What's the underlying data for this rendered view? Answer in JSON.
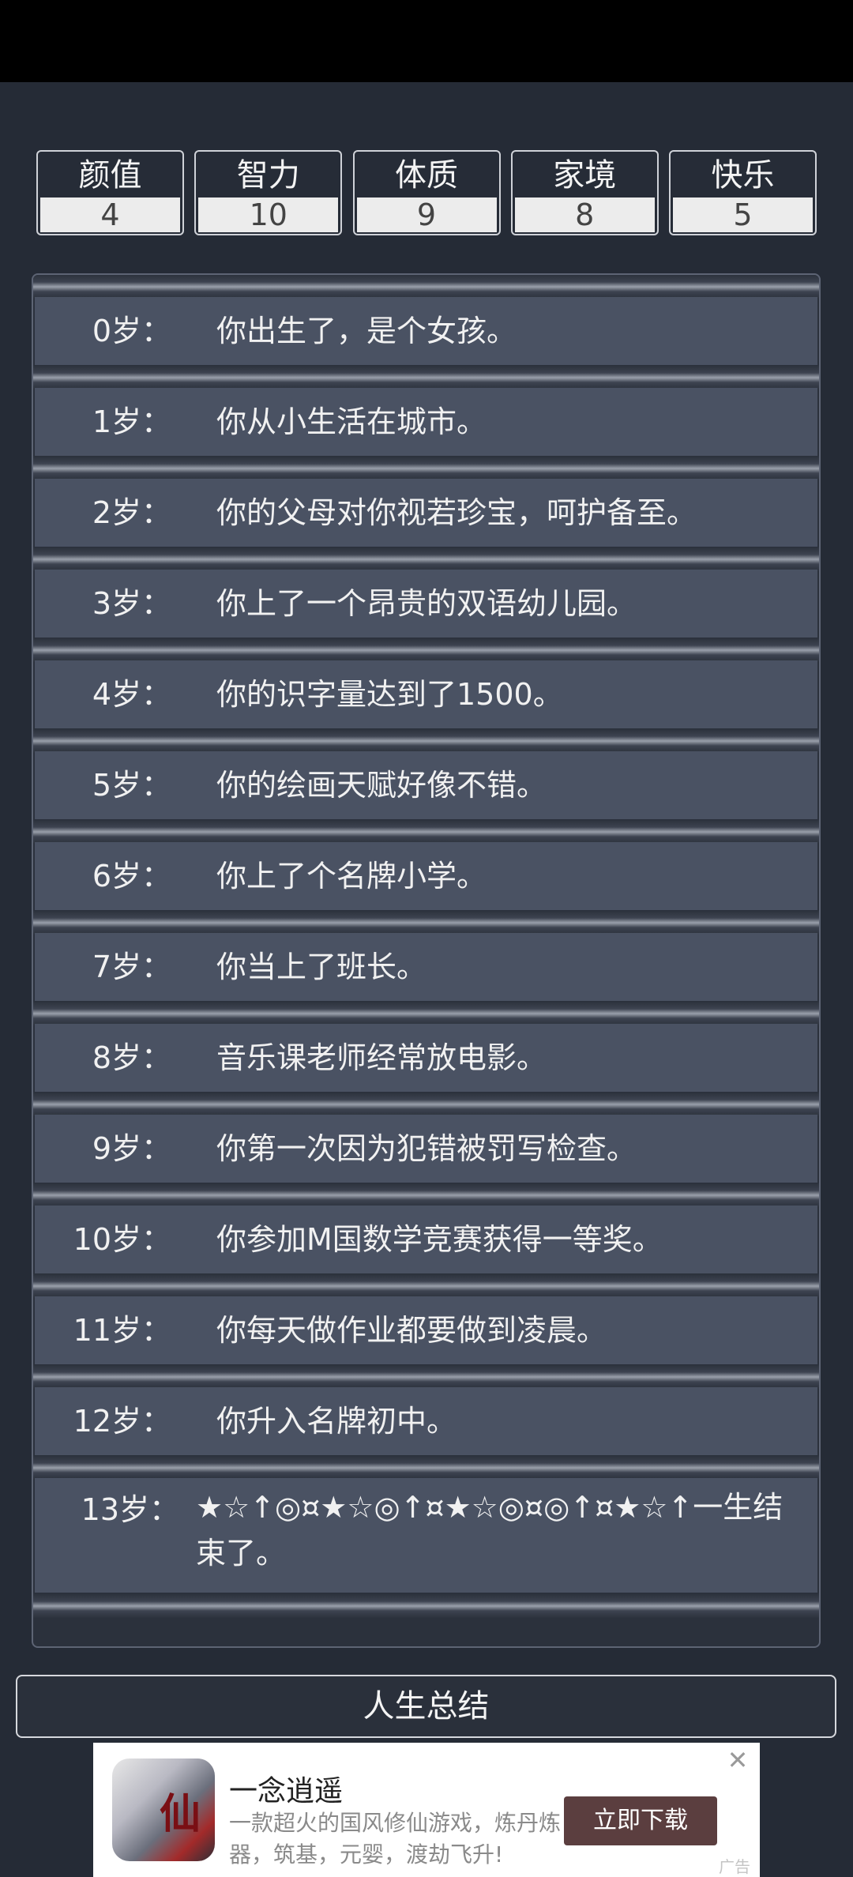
{
  "stats": [
    {
      "label": "颜值",
      "value": "4"
    },
    {
      "label": "智力",
      "value": "10"
    },
    {
      "label": "体质",
      "value": "9"
    },
    {
      "label": "家境",
      "value": "8"
    },
    {
      "label": "快乐",
      "value": "5"
    }
  ],
  "events": [
    {
      "age": "0岁：",
      "text": "你出生了，是个女孩。"
    },
    {
      "age": "1岁：",
      "text": "你从小生活在城市。"
    },
    {
      "age": "2岁：",
      "text": "你的父母对你视若珍宝，呵护备至。"
    },
    {
      "age": "3岁：",
      "text": "你上了一个昂贵的双语幼儿园。"
    },
    {
      "age": "4岁：",
      "text": "你的识字量达到了1500。"
    },
    {
      "age": "5岁：",
      "text": "你的绘画天赋好像不错。"
    },
    {
      "age": "6岁：",
      "text": "你上了个名牌小学。"
    },
    {
      "age": "7岁：",
      "text": "你当上了班长。"
    },
    {
      "age": "8岁：",
      "text": "音乐课老师经常放电影。"
    },
    {
      "age": "9岁：",
      "text": "你第一次因为犯错被罚写检查。"
    },
    {
      "age": "10岁：",
      "text": "你参加M国数学竞赛获得一等奖。"
    },
    {
      "age": "11岁：",
      "text": "你每天做作业都要做到凌晨。"
    },
    {
      "age": "12岁：",
      "text": "你升入名牌初中。"
    },
    {
      "age": "13岁：",
      "text": "★☆↑◎¤★☆◎↑¤★☆◎¤◎↑¤★☆↑一生结束了。"
    }
  ],
  "summary_button": "人生总结",
  "ad": {
    "icon_glyph": "仙",
    "title": "一念逍遥",
    "description": "一款超火的国风修仙游戏，炼丹炼器，筑基，元婴，渡劫飞升!",
    "cta": "立即下载",
    "tag": "广告",
    "close_icon": "close-icon"
  }
}
